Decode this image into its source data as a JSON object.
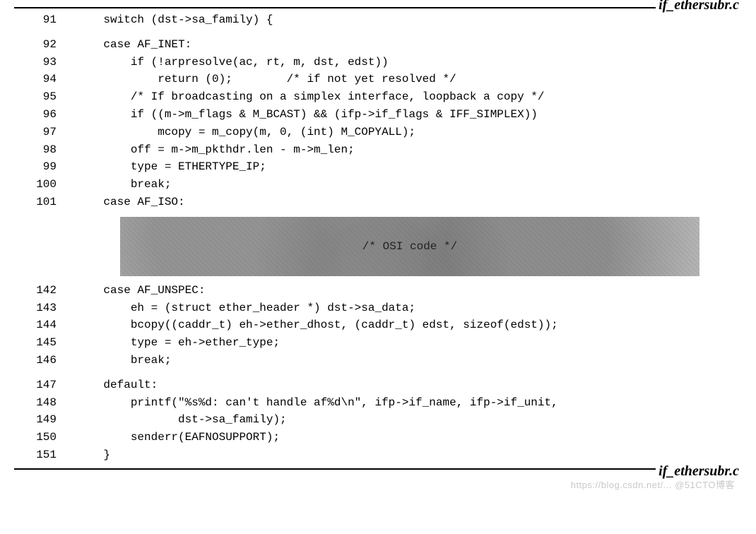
{
  "filename_top": "if_ethersubr.c",
  "filename_bottom": "if_ethersubr.c",
  "osi_comment": "/* OSI code */",
  "watermark": "https://blog.csdn.net/... @51CTO博客",
  "lines": [
    {
      "n": "91",
      "t": "    switch (dst->sa_family) {"
    },
    {
      "gap": true
    },
    {
      "n": "92",
      "t": "    case AF_INET:"
    },
    {
      "n": "93",
      "t": "        if (!arpresolve(ac, rt, m, dst, edst))"
    },
    {
      "n": "94",
      "t": "            return (0);        /* if not yet resolved */"
    },
    {
      "n": "95",
      "t": "        /* If broadcasting on a simplex interface, loopback a copy */"
    },
    {
      "n": "96",
      "t": "        if ((m->m_flags & M_BCAST) && (ifp->if_flags & IFF_SIMPLEX))"
    },
    {
      "n": "97",
      "t": "            mcopy = m_copy(m, 0, (int) M_COPYALL);"
    },
    {
      "n": "98",
      "t": "        off = m->m_pkthdr.len - m->m_len;"
    },
    {
      "n": "99",
      "t": "        type = ETHERTYPE_IP;"
    },
    {
      "n": "100",
      "t": "        break;"
    },
    {
      "n": "101",
      "t": "    case AF_ISO:"
    },
    {
      "osi": true
    },
    {
      "n": "142",
      "t": "    case AF_UNSPEC:"
    },
    {
      "n": "143",
      "t": "        eh = (struct ether_header *) dst->sa_data;"
    },
    {
      "n": "144",
      "t": "        bcopy((caddr_t) eh->ether_dhost, (caddr_t) edst, sizeof(edst));"
    },
    {
      "n": "145",
      "t": "        type = eh->ether_type;"
    },
    {
      "n": "146",
      "t": "        break;"
    },
    {
      "gap": true
    },
    {
      "n": "147",
      "t": "    default:"
    },
    {
      "n": "148",
      "t": "        printf(\"%s%d: can't handle af%d\\n\", ifp->if_name, ifp->if_unit,"
    },
    {
      "n": "149",
      "t": "               dst->sa_family);"
    },
    {
      "n": "150",
      "t": "        senderr(EAFNOSUPPORT);"
    },
    {
      "n": "151",
      "t": "    }"
    }
  ]
}
